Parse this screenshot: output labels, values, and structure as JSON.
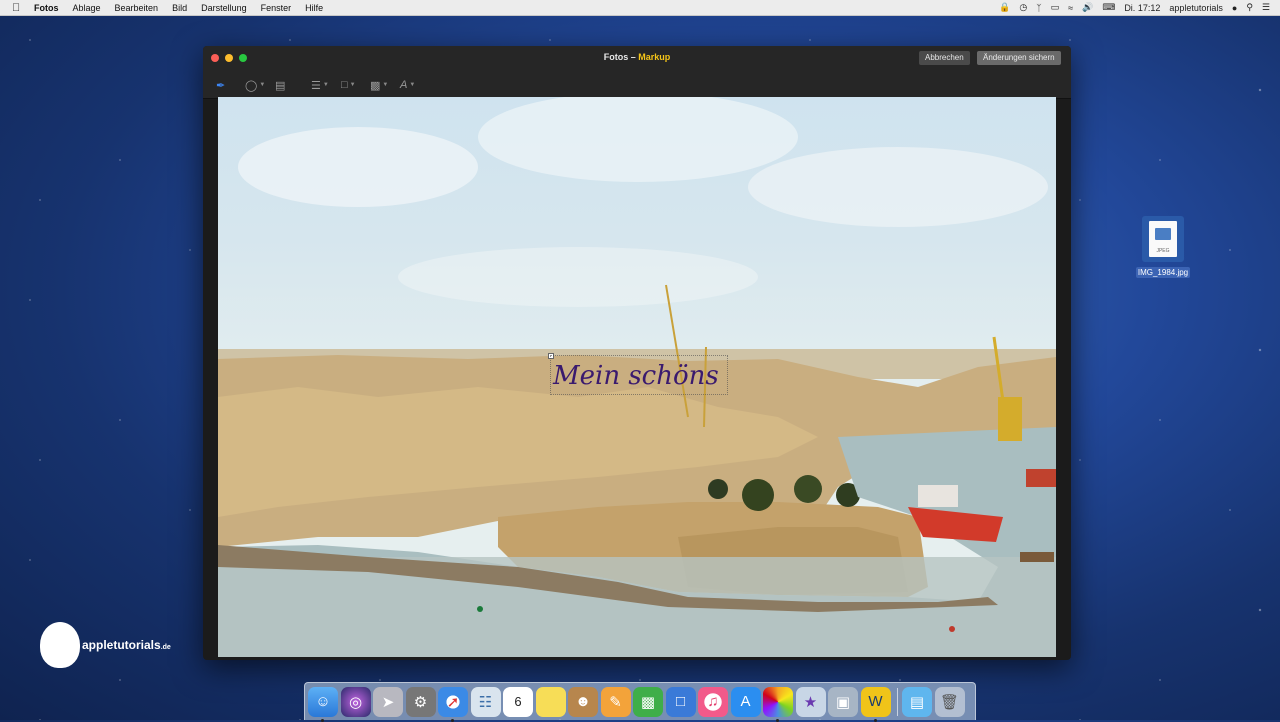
{
  "menubar": {
    "app_name": "Fotos",
    "menus": [
      "Ablage",
      "Bearbeiten",
      "Bild",
      "Darstellung",
      "Fenster",
      "Hilfe"
    ],
    "clock": "Di. 17:12",
    "user": "appletutorials"
  },
  "window": {
    "title": "Fotos",
    "title_separator": " – ",
    "subtitle": "Markup",
    "cancel_label": "Abbrechen",
    "save_label": "Änderungen sichern"
  },
  "markup": {
    "text": "Mein schöns"
  },
  "desktop": {
    "file_name": "IMG_1984.jpg",
    "file_type": "JPEG"
  },
  "watermark": {
    "name": "appletutorials",
    "suffix": ".de"
  },
  "dock": {
    "icons": [
      "finder-icon",
      "siri-icon",
      "launchpad-icon",
      "system-preferences-icon",
      "safari-icon",
      "preview-icon",
      "calendar-icon",
      "notes-icon",
      "contacts-icon",
      "pages-icon",
      "numbers-icon",
      "keynote-icon",
      "itunes-icon",
      "app-store-icon",
      "photos-icon",
      "imovie-icon",
      "image-capture-icon",
      "app-icon",
      "downloads-folder-icon",
      "trash-icon"
    ],
    "calendar_day": "6"
  },
  "colors": {
    "accent": "#3d86f4",
    "title_accent": "#f5c518",
    "markup_text": "#3a1a6e"
  }
}
